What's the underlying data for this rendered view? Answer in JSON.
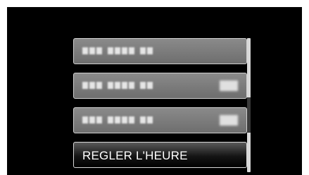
{
  "menu": {
    "items": [
      {
        "label": "",
        "blurred": true,
        "groups": [
          3,
          4,
          2
        ],
        "has_value_icon": false
      },
      {
        "label": "",
        "blurred": true,
        "groups": [
          3,
          4,
          2
        ],
        "has_value_icon": true
      },
      {
        "label": "",
        "blurred": true,
        "groups": [
          3,
          4,
          2
        ],
        "has_value_icon": true
      },
      {
        "label": "REGLER L'HEURE",
        "blurred": false,
        "selected": true
      }
    ]
  },
  "scrollbar": {
    "thumb_position": 0.6
  },
  "colors": {
    "background": "#000000",
    "item_fill": "#7a7a7a",
    "item_border": "#cfcfcf",
    "selected_fill": "#151515",
    "text": "#ffffff"
  }
}
